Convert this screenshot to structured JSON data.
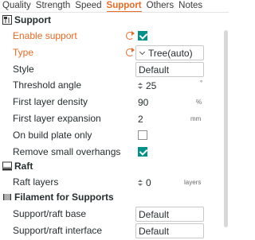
{
  "tabs": [
    {
      "label": "Quality"
    },
    {
      "label": "Strength"
    },
    {
      "label": "Speed"
    },
    {
      "label": "Support"
    },
    {
      "label": "Others"
    },
    {
      "label": "Notes"
    }
  ],
  "active_tab": "Support",
  "sections": {
    "support": {
      "title": "Support",
      "rows": {
        "enable_support": {
          "label": "Enable support",
          "checked": true
        },
        "type": {
          "label": "Type",
          "value": "Tree(auto)"
        },
        "style": {
          "label": "Style",
          "value": "Default"
        },
        "threshold_angle": {
          "label": "Threshold angle",
          "value": "25",
          "unit": "°"
        },
        "first_layer_density": {
          "label": "First layer density",
          "value": "90",
          "unit": "%"
        },
        "first_layer_expansion": {
          "label": "First layer expansion",
          "value": "2",
          "unit": "mm"
        },
        "on_build_plate_only": {
          "label": "On build plate only",
          "checked": false
        },
        "remove_small_overhangs": {
          "label": "Remove small overhangs",
          "checked": true
        }
      }
    },
    "raft": {
      "title": "Raft",
      "rows": {
        "raft_layers": {
          "label": "Raft layers",
          "value": "0",
          "unit": "layers"
        }
      }
    },
    "filament": {
      "title": "Filament for Supports",
      "rows": {
        "support_raft_base": {
          "label": "Support/raft base",
          "value": "Default"
        },
        "support_raft_interface": {
          "label": "Support/raft interface",
          "value": "Default"
        }
      }
    }
  },
  "colors": {
    "accent": "#ea6a26",
    "check": "#00908a",
    "text": "#262e30"
  }
}
